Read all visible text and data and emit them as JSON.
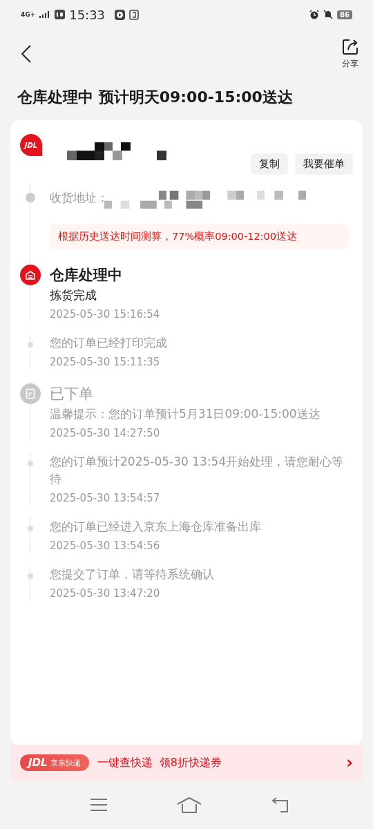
{
  "status_bar": {
    "network": "4G+",
    "time": "15:33",
    "battery": "86"
  },
  "header": {
    "share_label": "分享"
  },
  "title": "仓库处理中 预计明天09:00-15:00送达",
  "courier": {
    "logo": "JDL",
    "buttons": [
      "复制",
      "我要催单"
    ]
  },
  "address": {
    "label": "收货地址："
  },
  "estimate": "根据历史送达时间测算，77%概率09:00-12:00送达",
  "stages": [
    {
      "title": "仓库处理中",
      "kind": "warehouse",
      "active": true,
      "events": [
        {
          "text": "拣货完成",
          "time": "2025-05-30 15:16:54",
          "latest": true
        },
        {
          "text": "您的订单已经打印完成",
          "time": "2025-05-30 15:11:35",
          "latest": false
        }
      ]
    },
    {
      "title": "已下单",
      "kind": "order",
      "active": false,
      "events": [
        {
          "text": "温馨提示：您的订单预计5月31日09:00-15:00送达",
          "time": "2025-05-30 14:27:50",
          "latest": false
        },
        {
          "text": "您的订单预计2025-05-30 13:54开始处理，请您耐心等待",
          "time": "2025-05-30 13:54:57",
          "latest": false
        },
        {
          "text": "您的订单已经进入京东上海仓库准备出库",
          "time": "2025-05-30 13:54:56",
          "latest": false
        },
        {
          "text": "您提交了订单，请等待系统确认",
          "time": "2025-05-30 13:47:20",
          "latest": false
        }
      ]
    }
  ],
  "banner": {
    "badge_logo": "JDL",
    "badge_name": "京东快递",
    "text": "一键查快递  领8折快递券",
    "arrow": "›"
  }
}
